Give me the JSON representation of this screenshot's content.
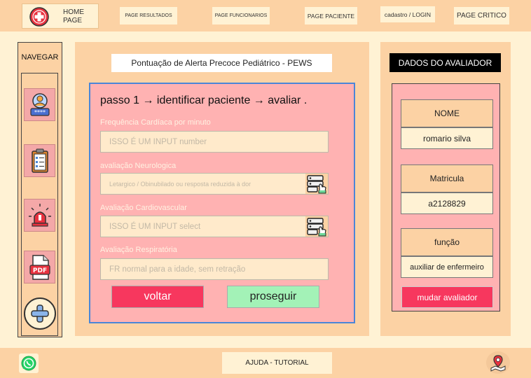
{
  "header": {
    "home_label_line1": "HOME",
    "home_label_line2": "PAGE",
    "nav": [
      {
        "label": "PAGE RESULTADOS"
      },
      {
        "label": "PAGE FUNCIONARIOS"
      },
      {
        "label": "PAGE PACIENTE"
      },
      {
        "label": "cadastro / LOGIN"
      },
      {
        "label": "PAGE CRITICO"
      }
    ]
  },
  "sidebar": {
    "title": "NAVEGAR",
    "items": [
      {
        "icon": "user-password-icon"
      },
      {
        "icon": "clipboard-icon"
      },
      {
        "icon": "alarm-siren-icon"
      },
      {
        "icon": "pdf-icon"
      },
      {
        "icon": "plus-icon"
      }
    ]
  },
  "main": {
    "title": "Pontuação de Alerta Precoce Pediátrico - PEWS",
    "step": "passo 1 → identificar paciente → avaliar .",
    "fields": [
      {
        "label": "Frequência Cardíaca por minuto",
        "placeholder": "ISSO É  UM INPUT number"
      },
      {
        "label": "avaliação Neurologica",
        "placeholder": "Letargico / Obinubilado ou resposta reduzida à dor"
      },
      {
        "label": "Avaliação Cardiovascular",
        "placeholder": "ISSO É  UM INPUT select"
      },
      {
        "label": "Avaliação Respiratória",
        "placeholder": "FR normal para a idade, sem retração"
      }
    ],
    "back_label": "voltar",
    "next_label": "proseguir"
  },
  "evaluator": {
    "title": "DADOS DO AVALIADOR",
    "name_label": "NOME",
    "name_value": "romario silva",
    "id_label": "Matricula",
    "id_value": "a2128829",
    "role_label": "função",
    "role_value": "auxiliar de enfermeiro",
    "change_label": "mudar avaliador"
  },
  "footer": {
    "help_label": "AJUDA - TUTORIAL"
  },
  "colors": {
    "background": "#fff2d4",
    "bar": "#fcd2a4",
    "panel_pink": "#ffb2b2",
    "danger": "#f7375e",
    "success": "#a3f2b7",
    "form_border": "#4a86d8"
  }
}
